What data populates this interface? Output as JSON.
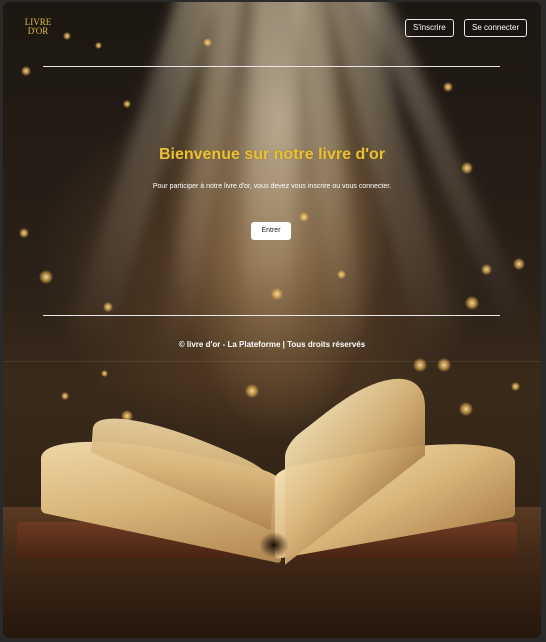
{
  "header": {
    "logo_line1": "LIVRE",
    "logo_line2": "D'OR",
    "signup_label": "S'inscrire",
    "login_label": "Se connecter"
  },
  "hero": {
    "title": "Bienvenue sur notre livre d'or",
    "subtitle": "Pour participer à notre livre d'or, vous devez vous inscrire ou vous connecter.",
    "enter_label": "Entrer"
  },
  "footer": {
    "text": "© livre d'or - La Plateforme | Tous droits réservés"
  },
  "colors": {
    "accent": "#e9c034",
    "logo": "#e6b84a",
    "text": "#ffffff"
  }
}
